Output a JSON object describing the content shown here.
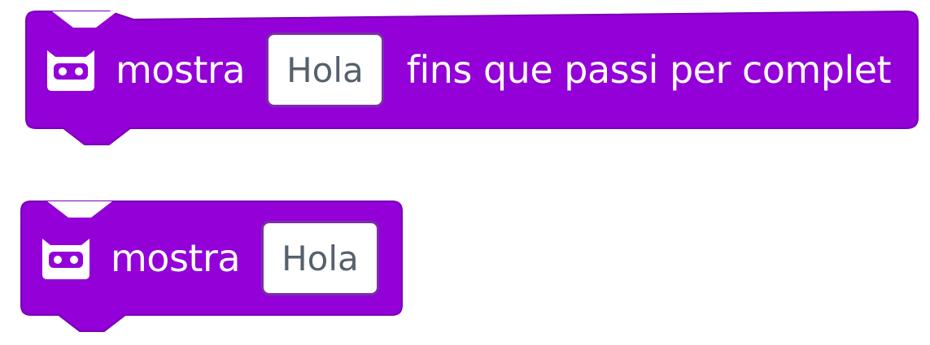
{
  "colors": {
    "block_fill": "#9300d8",
    "block_border": "#7a00b4",
    "input_text": "#56616e",
    "icon": "#ffffff"
  },
  "blocks": [
    {
      "icon": "robot-icon",
      "label": "mostra",
      "input_value": "Hola",
      "suffix": "fins que passi per complet"
    },
    {
      "icon": "robot-icon",
      "label": "mostra",
      "input_value": "Hola"
    }
  ]
}
